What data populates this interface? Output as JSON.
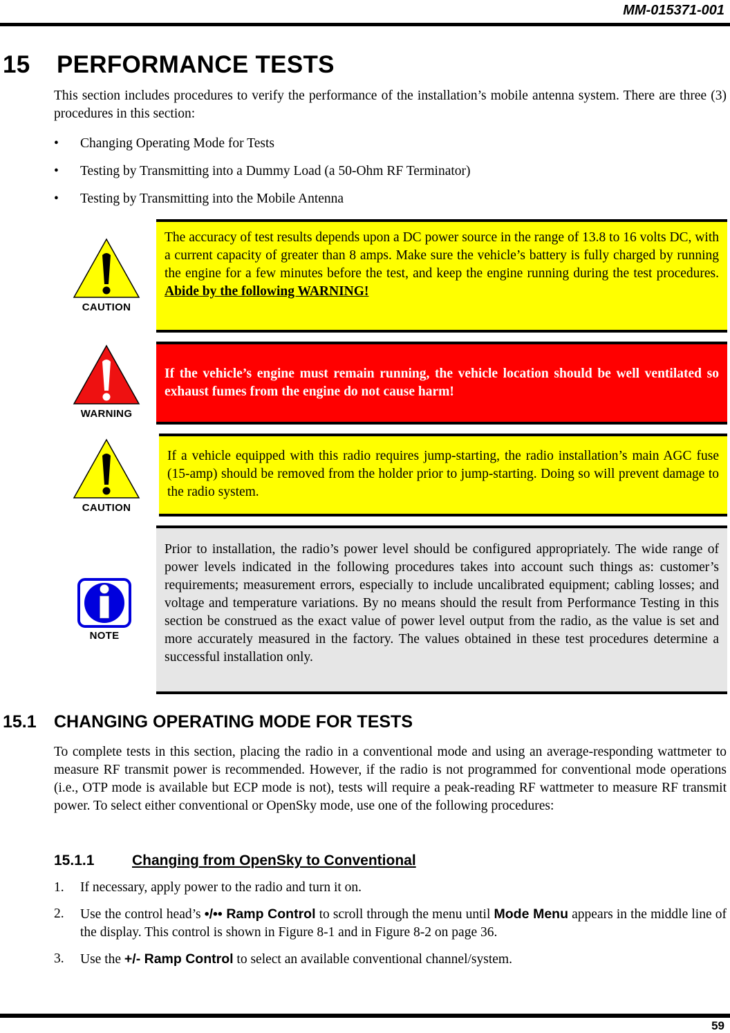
{
  "header": {
    "doc_id": "MM-015371-001"
  },
  "footer": {
    "page_number": "59"
  },
  "section": {
    "number": "15",
    "title": "PERFORMANCE TESTS",
    "intro": "This section includes procedures to verify the performance of the installation’s mobile antenna system. There are three (3) procedures in this section:",
    "bullets": [
      "Changing Operating Mode for Tests",
      "Testing by Transmitting into a Dummy Load (a 50-Ohm RF Terminator)",
      "Testing by Transmitting into the Mobile Antenna"
    ]
  },
  "notices": [
    {
      "type": "caution",
      "icon": "caution-triangle-icon",
      "label": "CAUTION",
      "text": "The accuracy of test results depends upon a DC power source in the range of 13.8 to 16 volts DC, with a current capacity of greater than 8 amps. Make sure the vehicle’s battery is fully charged by running the engine for a few minutes before the test, and keep the engine running during the test procedures.",
      "emphasis": "Abide by the following WARNING!",
      "color": "#ffff00"
    },
    {
      "type": "warning",
      "icon": "warning-triangle-icon",
      "label": "WARNING",
      "text": "If the vehicle’s engine must remain running, the vehicle location should be well ventilated so exhaust fumes from the engine do not cause harm!",
      "color": "#ff0000"
    },
    {
      "type": "caution",
      "icon": "caution-triangle-icon",
      "label": "CAUTION",
      "text": "If a vehicle equipped with this radio requires jump-starting, the radio installation’s main AGC fuse (15-amp) should be removed from the holder prior to jump-starting. Doing so will prevent damage to the radio system.",
      "color": "#ffff00"
    },
    {
      "type": "note",
      "icon": "info-note-icon",
      "label": "NOTE",
      "text": "Prior to installation, the radio’s power level should be configured appropriately. The wide range of power levels indicated in the following procedures takes into account such things as: customer’s requirements; measurement errors, especially to include uncalibrated equipment; cabling losses; and voltage and temperature variations. By no means should the result from Performance Testing in this section be construed as the exact value of power level output from the radio, as the value is set and more accurately measured in the factory. The values obtained in these test procedures determine a successful installation only.",
      "color": "#e6e6e6"
    }
  ],
  "subsection": {
    "number": "15.1",
    "title": "CHANGING OPERATING MODE FOR TESTS",
    "text": "To complete tests in this section, placing the radio in a conventional mode and using an average-responding wattmeter to measure RF transmit power is recommended. However, if the radio is not programmed for conventional mode operations (i.e., OTP mode is available but ECP mode is not), tests will require a peak-reading RF wattmeter to measure RF transmit power. To select either conventional or OpenSky mode, use one of the following procedures:"
  },
  "subsubsection": {
    "number": "15.1.1",
    "title": "Changing from OpenSky to Conventional",
    "steps": [
      {
        "n": "1.",
        "text": "If necessary, apply power to the radio and turn it on."
      },
      {
        "n": "2.",
        "pre": "Use the control head’s ",
        "control": "•/•• Ramp Control",
        "mid": " to scroll through the menu until ",
        "menu": "Mode Menu",
        "post": " appears in the middle line of the display. This control is shown in Figure 8-1 and in Figure 8-2 on page 36."
      },
      {
        "n": "3.",
        "pre": "Use the ",
        "control": "+/- Ramp Control",
        "post": " to select an available conventional channel/system."
      }
    ]
  }
}
